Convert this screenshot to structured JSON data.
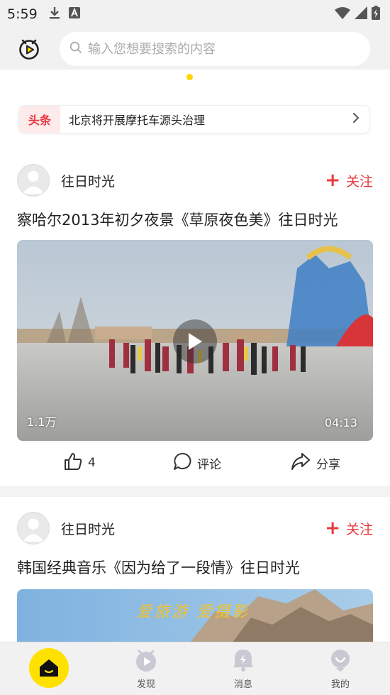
{
  "status_bar": {
    "time": "5:59",
    "icons": [
      "download-icon",
      "keyboard-a-icon",
      "wifi-icon",
      "signal-icon",
      "battery-charging-icon"
    ]
  },
  "header": {
    "logo_icon": "video-play-logo-icon",
    "search_placeholder": "输入您想要搜索的内容"
  },
  "ticker": {
    "badge": "头条",
    "headline": "北京将开展摩托车源头治理"
  },
  "posts": [
    {
      "author": "往日时光",
      "follow_label": "关注",
      "title": "察哈尔2013年初夕夜景《草原夜色美》往日时光",
      "views": "1.1万",
      "duration": "04:13",
      "likes": "4",
      "comment_label": "评论",
      "share_label": "分享"
    },
    {
      "author": "往日时光",
      "follow_label": "关注",
      "title": "韩国经典音乐《因为给了一段情》往日时光",
      "thumbnail_caption": "爱旅游 爱摄影"
    }
  ],
  "bottom_nav": {
    "items": [
      {
        "label": "",
        "icon": "home-icon",
        "active": true
      },
      {
        "label": "发现",
        "icon": "discover-icon"
      },
      {
        "label": "消息",
        "icon": "bell-icon"
      },
      {
        "label": "我的",
        "icon": "profile-icon"
      }
    ]
  },
  "colors": {
    "accent_yellow": "#ffe100",
    "follow_red": "#e8383d",
    "ticker_badge_bg": "#fdeaea"
  }
}
